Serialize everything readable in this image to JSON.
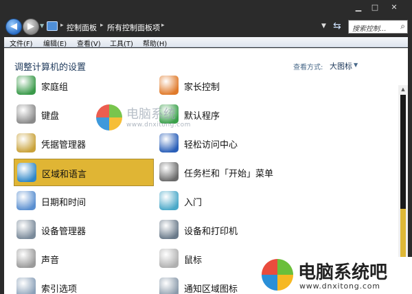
{
  "window_controls": {
    "minimize": "▁",
    "maximize": "□",
    "close": "✕"
  },
  "address": {
    "back_arrow": "◀",
    "forward_arrow": "▶",
    "breadcrumbs": [
      "控制面板",
      "所有控制面板项"
    ],
    "separator": "▸",
    "search_placeholder": "搜索控制...",
    "search_icon": "search-icon"
  },
  "menu": [
    "文件(F)",
    "编辑(E)",
    "查看(V)",
    "工具(T)",
    "帮助(H)"
  ],
  "content": {
    "heading": "调整计算机的设置",
    "view_by_label": "查看方式:",
    "view_by_value": "大图标"
  },
  "items": [
    {
      "label": "家庭组",
      "icon": "homegroup-icon",
      "color": "#3a9a4a"
    },
    {
      "label": "家长控制",
      "icon": "parental-controls-icon",
      "color": "#e07a2a"
    },
    {
      "label": "键盘",
      "icon": "keyboard-icon",
      "color": "#8a8a8a"
    },
    {
      "label": "默认程序",
      "icon": "default-programs-icon",
      "color": "#3aa04a"
    },
    {
      "label": "凭据管理器",
      "icon": "credential-manager-icon",
      "color": "#c9a23a"
    },
    {
      "label": "轻松访问中心",
      "icon": "ease-of-access-icon",
      "color": "#2a5fb8"
    },
    {
      "label": "区域和语言",
      "icon": "region-language-icon",
      "color": "#2f87c8",
      "selected": true
    },
    {
      "label": "任务栏和「开始」菜单",
      "icon": "taskbar-icon",
      "color": "#6a6a6a"
    },
    {
      "label": "日期和时间",
      "icon": "date-time-icon",
      "color": "#5a8fd0"
    },
    {
      "label": "入门",
      "icon": "getting-started-icon",
      "color": "#4aa8c8"
    },
    {
      "label": "设备管理器",
      "icon": "device-manager-icon",
      "color": "#7a8a9a"
    },
    {
      "label": "设备和打印机",
      "icon": "devices-printers-icon",
      "color": "#6a7a8a"
    },
    {
      "label": "声音",
      "icon": "sound-icon",
      "color": "#9a9a9a"
    },
    {
      "label": "鼠标",
      "icon": "mouse-icon",
      "color": "#b0b0b0"
    },
    {
      "label": "索引选项",
      "icon": "indexing-icon",
      "color": "#8aa0b8"
    },
    {
      "label": "通知区域图标",
      "icon": "notification-area-icon",
      "color": "#8a9aaa"
    }
  ],
  "watermark": {
    "name": "电脑系统吧",
    "url": "www.dnxitong.com",
    "center_name": "电脑系统",
    "center_url": "www.dnxitong.com"
  },
  "colors": {
    "selected_bg": "#e0b534",
    "heading": "#1e395b"
  }
}
